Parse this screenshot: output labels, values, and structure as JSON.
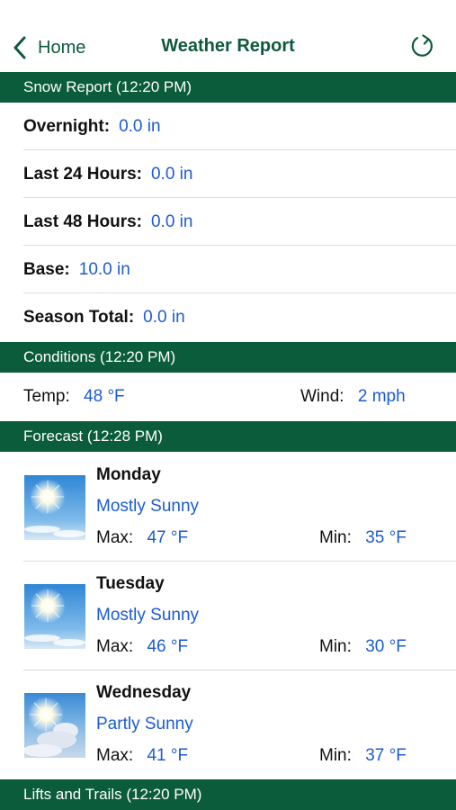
{
  "nav": {
    "back_label": "Home",
    "title": "Weather Report"
  },
  "snow_report": {
    "header": "Snow Report (12:20 PM)",
    "rows": [
      {
        "label": "Overnight:",
        "value": "0.0 in"
      },
      {
        "label": "Last 24 Hours:",
        "value": "0.0 in"
      },
      {
        "label": "Last 48 Hours:",
        "value": "0.0 in"
      },
      {
        "label": "Base:",
        "value": "10.0 in"
      },
      {
        "label": "Season Total:",
        "value": "0.0 in"
      }
    ]
  },
  "conditions": {
    "header": "Conditions (12:20 PM)",
    "temp_label": "Temp:",
    "temp_value": "48 °F",
    "wind_label": "Wind:",
    "wind_value": "2 mph"
  },
  "forecast": {
    "header": "Forecast (12:28 PM)",
    "days": [
      {
        "day": "Monday",
        "condition": "Mostly Sunny",
        "max_label": "Max:",
        "max": "47 °F",
        "min_label": "Min:",
        "min": "35 °F",
        "icon": "mostly-sunny-icon"
      },
      {
        "day": "Tuesday",
        "condition": "Mostly Sunny",
        "max_label": "Max:",
        "max": "46 °F",
        "min_label": "Min:",
        "min": "30 °F",
        "icon": "mostly-sunny-icon"
      },
      {
        "day": "Wednesday",
        "condition": "Partly Sunny",
        "max_label": "Max:",
        "max": "41 °F",
        "min_label": "Min:",
        "min": "37 °F",
        "icon": "partly-sunny-icon"
      }
    ]
  },
  "lifts": {
    "header": "Lifts and Trails (12:20 PM)"
  },
  "colors": {
    "brand_green": "#0b5c3b",
    "value_blue": "#1c5bd1"
  }
}
